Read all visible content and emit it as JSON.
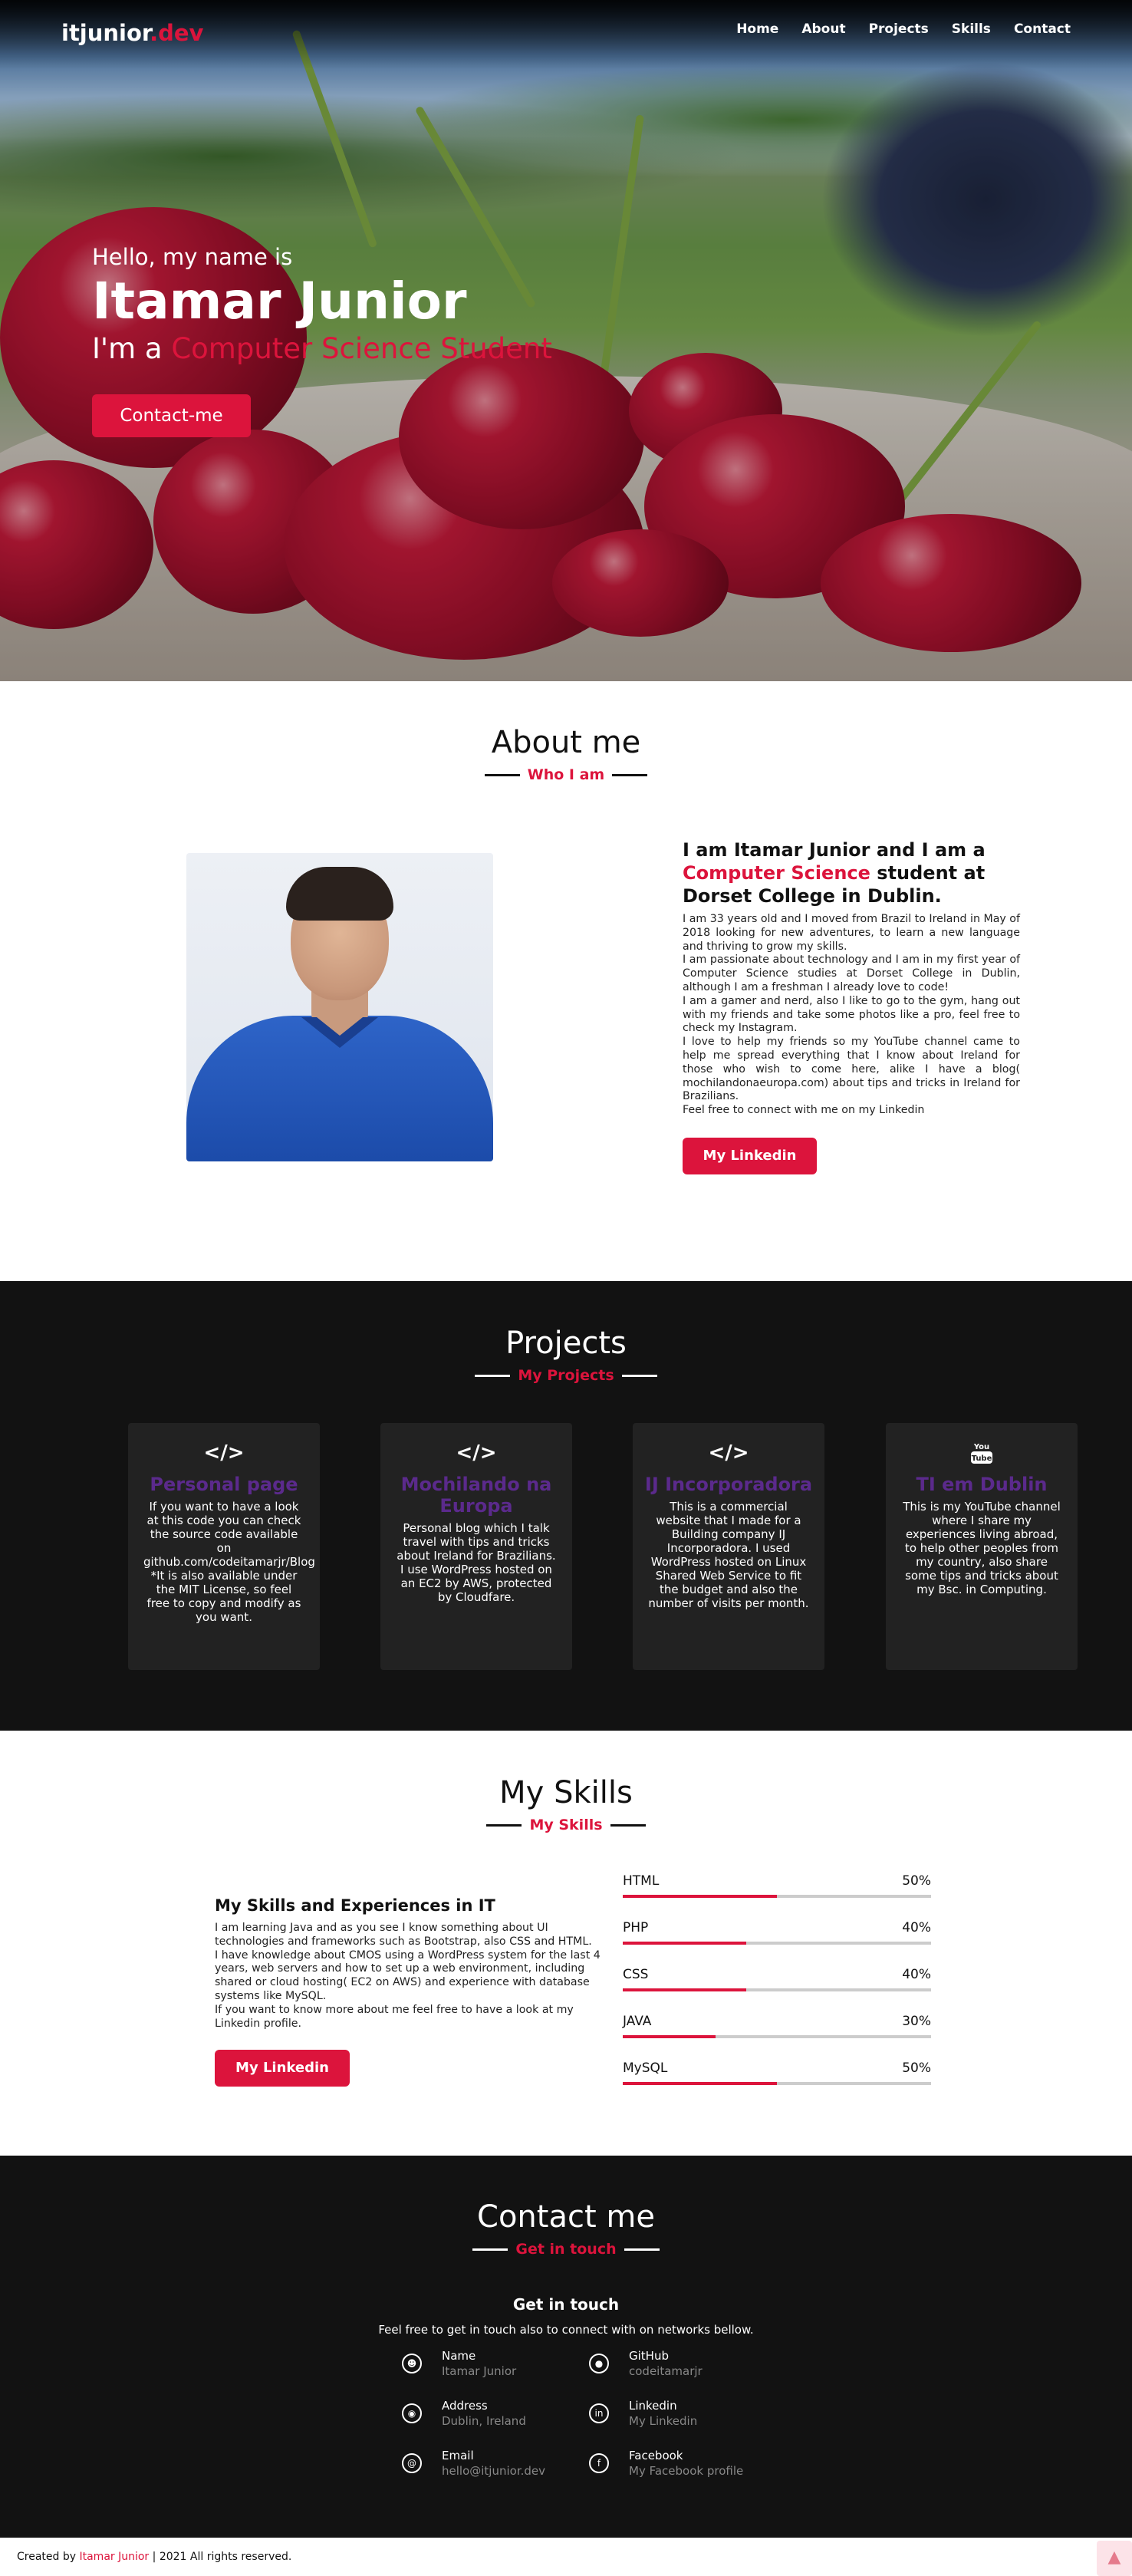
{
  "brand": {
    "logo_main": "itjunior",
    "logo_accent": ".dev"
  },
  "nav": {
    "items": [
      "Home",
      "About",
      "Projects",
      "Skills",
      "Contact"
    ]
  },
  "hero": {
    "hello": "Hello, my name is",
    "name": "Itamar Junior",
    "role_prefix": "I'm a ",
    "role_typed": "Computer Science Student",
    "button": "Contact-me"
  },
  "about": {
    "title": "About me",
    "subtitle": "Who I am",
    "heading_pre": "I am Itamar Junior and I am a ",
    "heading_accent": "Computer Science",
    "heading_post": " student at Dorset College in Dublin.",
    "paragraphs": [
      "I am 33 years old and I moved from Brazil to Ireland in May of 2018 looking for new adventures, to learn a new language and thriving to grow my skills.",
      "I am passionate about technology and I am in my first year of Computer Science studies at Dorset College in Dublin, although I am a freshman I already love to code!",
      "I am a gamer and nerd, also I like to go to the gym, hang out with my friends and take some photos like a pro, feel free to check my Instagram.",
      "I love to help my friends so my YouTube channel came to help me spread everything that I know about Ireland for those who wish to come here, alike I have a blog( mochilandonaeuropa.com) about tips and tricks in Ireland for Brazilians.",
      "Feel free to connect with me on my Linkedin"
    ],
    "button": "My Linkedin"
  },
  "projects": {
    "title": "Projects",
    "subtitle": "My Projects",
    "cards": [
      {
        "icon": "code-icon",
        "icon_text": "</>",
        "title": "Personal page",
        "desc": "If you want to have a look at this code you can check the source code available on github.com/codeitamarjr/Blog *It is also available under the MIT License, so feel free to copy and modify as you want."
      },
      {
        "icon": "code-icon",
        "icon_text": "</>",
        "title": "Mochilando na Europa",
        "desc": "Personal blog which I talk travel with tips and tricks about Ireland for Brazilians. I use WordPress hosted on an EC2 by AWS, protected by Cloudfare."
      },
      {
        "icon": "code-icon",
        "icon_text": "</>",
        "title": "IJ Incorporadora",
        "desc": "This is a commercial website that I made for a Building company IJ Incorporadora. I used WordPress hosted on Linux Shared Web Service to fit the budget and also the number of visits per month."
      },
      {
        "icon": "youtube-icon",
        "icon_text": "You Tube",
        "title": "TI em Dublin",
        "desc": "This is my YouTube channel where I share my experiences living abroad, to help other peoples from my country, also share some tips and tricks about my Bsc. in Computing."
      }
    ]
  },
  "skills": {
    "title": "My Skills",
    "subtitle": "My Skills",
    "heading": "My Skills and Experiences in IT",
    "paragraphs": [
      "I am learning Java and as you see I know something about UI technologies and frameworks such as Bootstrap, also CSS and HTML.",
      "I have knowledge about CMOS using a WordPress system for the last 4 years, web servers and how to set up a web environment, including shared or cloud hosting( EC2 on AWS) and experience with database systems like MySQL.",
      "If you want to know more about me feel free to have a look at my Linkedin profile."
    ],
    "button": "My Linkedin",
    "bars": [
      {
        "name": "HTML",
        "label": "50%",
        "value": 0.5
      },
      {
        "name": "PHP",
        "label": "40%",
        "value": 0.4
      },
      {
        "name": "CSS",
        "label": "40%",
        "value": 0.4
      },
      {
        "name": "JAVA",
        "label": "30%",
        "value": 0.3
      },
      {
        "name": "MySQL",
        "label": "50%",
        "value": 0.5
      }
    ]
  },
  "contact": {
    "title": "Contact me",
    "subtitle": "Get in touch",
    "get": "Get in touch",
    "free": "Feel free to get in touch also to connect with on networks bellow.",
    "items": [
      {
        "icon": "user-icon",
        "label": "Name",
        "value": "Itamar Junior"
      },
      {
        "icon": "github-icon",
        "label": "GitHub",
        "value": "codeitamarjr"
      },
      {
        "icon": "map-pin-icon",
        "label": "Address",
        "value": "Dublin, Ireland"
      },
      {
        "icon": "linkedin-icon",
        "label": "Linkedin",
        "value": "My Linkedin"
      },
      {
        "icon": "email-icon",
        "label": "Email",
        "value": "hello@itjunior.dev"
      },
      {
        "icon": "facebook-icon",
        "label": "Facebook",
        "value": "My Facebook profile"
      }
    ]
  },
  "footer": {
    "pre": "Created by ",
    "name": "Itamar Junior",
    "post": " | 2021 All rights reserved."
  },
  "colors": {
    "accent": "#dc143c",
    "dark": "#121212",
    "card": "#222222",
    "card_title": "#5b2a8c"
  }
}
